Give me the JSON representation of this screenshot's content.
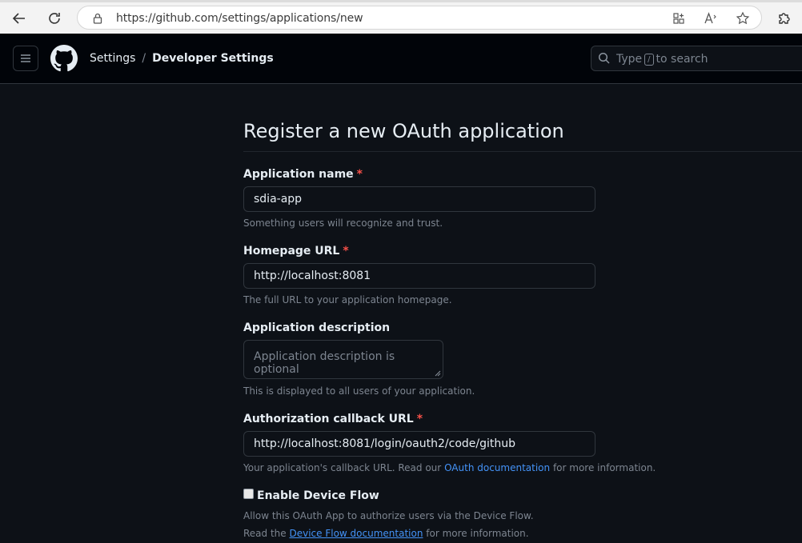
{
  "browser": {
    "url": "https://github.com/settings/applications/new"
  },
  "header": {
    "crumb_settings": "Settings",
    "crumb_separator": "/",
    "crumb_developer": "Developer Settings",
    "search_prefix": "Type",
    "search_key": "/",
    "search_suffix": "to search"
  },
  "form": {
    "title": "Register a new OAuth application",
    "required_mark": "*",
    "app_name": {
      "label": "Application name",
      "value": "sdia-app",
      "hint": "Something users will recognize and trust."
    },
    "homepage": {
      "label": "Homepage URL",
      "value": "http://localhost:8081",
      "hint": "The full URL to your application homepage."
    },
    "description": {
      "label": "Application description",
      "placeholder": "Application description is optional",
      "hint": "This is displayed to all users of your application."
    },
    "callback": {
      "label": "Authorization callback URL",
      "value": "http://localhost:8081/login/oauth2/code/github",
      "hint_before": "Your application's callback URL. Read our",
      "hint_link": "OAuth documentation",
      "hint_after": "for more information."
    },
    "device_flow": {
      "label": "Enable Device Flow",
      "hint1": "Allow this OAuth App to authorize users via the Device Flow.",
      "hint2_before": "Read the",
      "hint2_link": "Device Flow documentation",
      "hint2_after": "for more information."
    }
  },
  "colors": {
    "background": "#0d1117",
    "required": "#f85149",
    "link": "#4493f8"
  }
}
